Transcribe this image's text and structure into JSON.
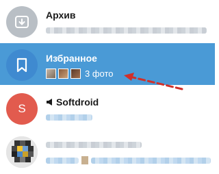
{
  "chats": [
    {
      "id": "archive",
      "title": "Архив",
      "icon": "archive-icon"
    },
    {
      "id": "saved",
      "title": "Избранное",
      "icon": "bookmark-icon",
      "preview_label": "3 фото"
    },
    {
      "id": "softdroid",
      "title": "Softdroid",
      "avatar_letter": "S",
      "icon": "megaphone-icon"
    },
    {
      "id": "unknown",
      "title": ""
    }
  ],
  "colors": {
    "selected_bg": "#4a9ad6",
    "softdroid_avatar": "#e25b4e",
    "annotation_arrow": "#d0302a"
  }
}
